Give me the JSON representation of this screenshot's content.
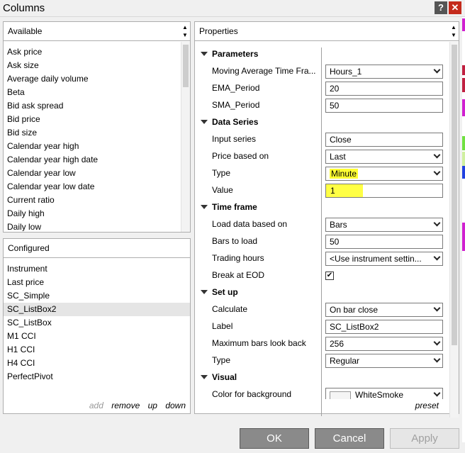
{
  "window": {
    "title": "Columns",
    "help_label": "?",
    "close_label": "✕"
  },
  "available": {
    "header": "Available",
    "items": [
      "Ask price",
      "Ask size",
      "Average daily volume",
      "Beta",
      "Bid ask spread",
      "Bid price",
      "Bid size",
      "Calendar year high",
      "Calendar year high date",
      "Calendar year low",
      "Calendar year low date",
      "Current ratio",
      "Daily high",
      "Daily low"
    ]
  },
  "configured": {
    "header": "Configured",
    "items": [
      "Instrument",
      "Last price",
      "SC_Simple",
      "SC_ListBox2",
      "SC_ListBox",
      "M1 CCI",
      "H1 CCI",
      "H4 CCI",
      "PerfectPivot"
    ],
    "selected": "SC_ListBox2",
    "actions": {
      "add": "add",
      "remove": "remove",
      "up": "up",
      "down": "down"
    }
  },
  "properties": {
    "header": "Properties",
    "preset_label": "preset",
    "parameters": {
      "title": "Parameters",
      "ma_timeframe_label": "Moving Average Time Fra...",
      "ma_timeframe_value": "Hours_1",
      "ema_label": "EMA_Period",
      "ema_value": "20",
      "sma_label": "SMA_Period",
      "sma_value": "50"
    },
    "data_series": {
      "title": "Data Series",
      "input_label": "Input series",
      "input_value": "Close",
      "price_label": "Price based on",
      "price_value": "Last",
      "type_label": "Type",
      "type_value": "Minute",
      "value_label": "Value",
      "value_value": "1"
    },
    "time_frame": {
      "title": "Time frame",
      "load_label": "Load data based on",
      "load_value": "Bars",
      "bars_label": "Bars to load",
      "bars_value": "50",
      "hours_label": "Trading hours",
      "hours_value": "<Use instrument settin...",
      "eod_label": "Break at EOD",
      "eod_checked": "✔"
    },
    "setup": {
      "title": "Set up",
      "calc_label": "Calculate",
      "calc_value": "On bar close",
      "label_label": "Label",
      "label_value": "SC_ListBox2",
      "maxbars_label": "Maximum bars look back",
      "maxbars_value": "256",
      "type_label": "Type",
      "type_value": "Regular"
    },
    "visual": {
      "title": "Visual",
      "bg_label": "Color for background",
      "bg_value": "WhiteSmoke"
    }
  },
  "buttons": {
    "ok": "OK",
    "cancel": "Cancel",
    "apply": "Apply"
  },
  "colors": {
    "close": "#c42b1c",
    "button": "#8a8a8a",
    "highlight": "#ffff33"
  }
}
